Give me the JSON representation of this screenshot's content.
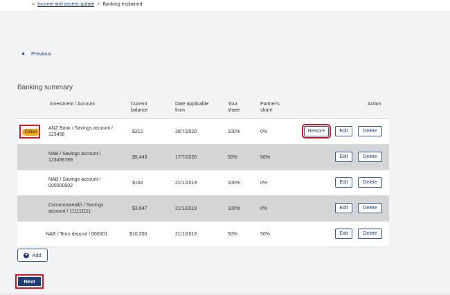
{
  "breadcrumb": {
    "link": "Income and assets update",
    "separator": ">",
    "current": "Banking explained"
  },
  "previous": {
    "label": "Previous",
    "icon": "chevron-up-icon"
  },
  "summary_title": "Banking summary",
  "table": {
    "headers": {
      "account": "Investment / Account",
      "balance_1": "Current",
      "balance_2": "balance",
      "date_1": "Date applicable",
      "date_2": "from",
      "your_1": "Your",
      "your_2": "share",
      "partner_1": "Partner's",
      "partner_2": "share",
      "action": "Action"
    },
    "rows": [
      {
        "badge": "Edited",
        "account_1": "ANZ Bank / Savings account /",
        "account_2": "123456",
        "balance": "$212",
        "date": "28/7/2020",
        "your_share": "100%",
        "partner_share": "0%",
        "restore": "Restore",
        "edit": "Edit",
        "delete": "Delete"
      },
      {
        "account_1": "NAB / Savings account /",
        "account_2": "123456789",
        "balance": "$5,443",
        "date": "17/7/2020",
        "your_share": "50%",
        "partner_share": "50%",
        "edit": "Edit",
        "delete": "Delete"
      },
      {
        "account_1": "NAB / Savings account /",
        "account_2": "000000002",
        "balance": "$164",
        "date": "21/1/2019",
        "your_share": "100%",
        "partner_share": "0%",
        "edit": "Edit",
        "delete": "Delete"
      },
      {
        "account_1": "Commonwealth / Savings",
        "account_2": "account / 111111111",
        "balance": "$3,647",
        "date": "21/1/2019",
        "your_share": "100%",
        "partner_share": "0%",
        "edit": "Edit",
        "delete": "Delete"
      },
      {
        "account_1": "NAB / Term deposit / 000001",
        "account_2": "",
        "balance": "$10,200",
        "date": "21/1/2019",
        "your_share": "50%",
        "partner_share": "50%",
        "edit": "Edit",
        "delete": "Delete"
      }
    ]
  },
  "add_button": {
    "label": "Add",
    "icon": "plus-circle-icon"
  },
  "next_button": {
    "label": "Next"
  },
  "colors": {
    "accent": "#1e3f7a",
    "highlight": "#e0101e",
    "badge": "#f0a81c"
  }
}
